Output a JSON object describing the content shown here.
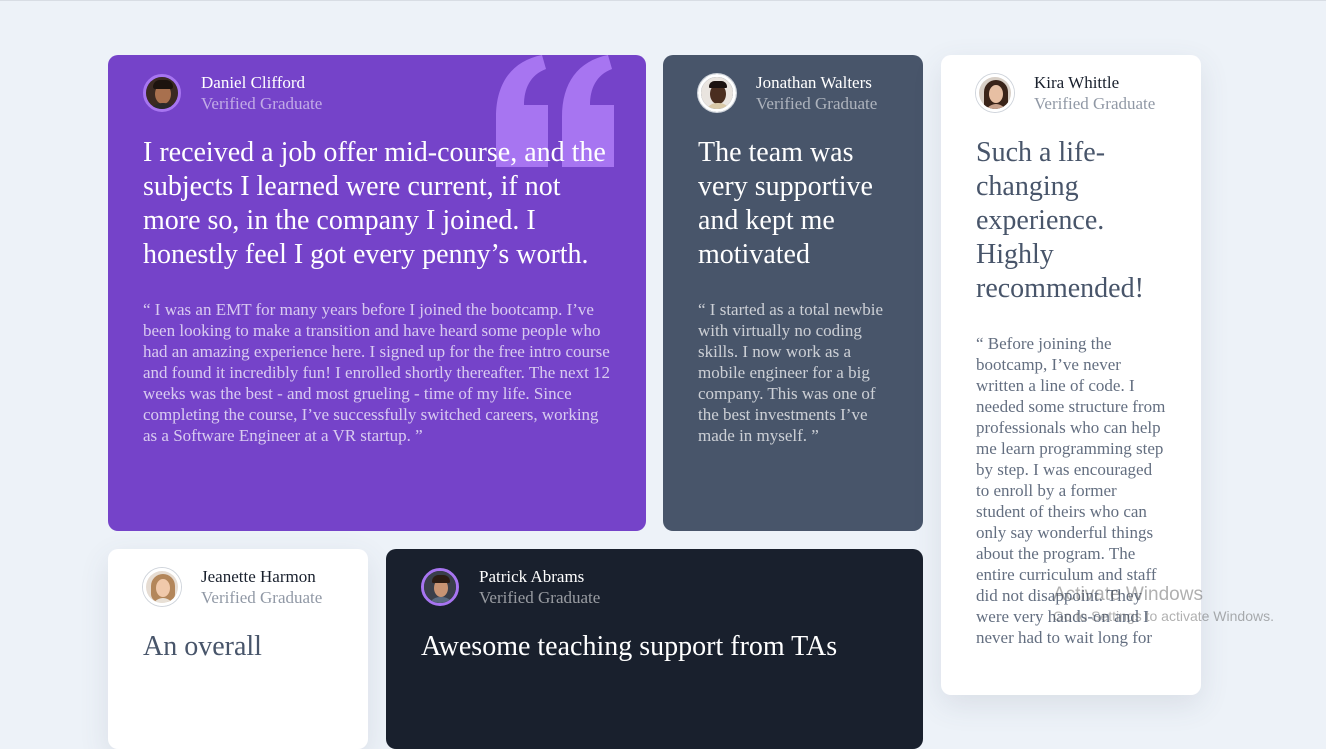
{
  "testimonials": [
    {
      "name": "Daniel Clifford",
      "role": "Verified Graduate",
      "title": "I received a job offer mid-course, and the subjects I learned were current, if not more so, in the company I joined. I honestly feel I got every penny’s worth.",
      "body": "“ I was an EMT for many years before I joined the bootcamp. I’ve been looking to make a transition and have heard some people who had an amazing experience here. I signed up for the free intro course and found it incredibly fun! I enrolled shortly thereafter. The next 12 weeks was the best - and most grueling - time of my life. Since completing the course, I’ve successfully switched careers, working as a Software Engineer at a VR startup. ”"
    },
    {
      "name": "Jonathan Walters",
      "role": "Verified Graduate",
      "title": "The team was very supportive and kept me motivated",
      "body": "“ I started as a total newbie with virtually no coding skills. I now work as a mobile engineer for a big company. This was one of the best investments I’ve made in myself. ”"
    },
    {
      "name": "Kira Whittle",
      "role": "Verified Graduate",
      "title": "Such a life-changing experience. Highly recommended!",
      "body": "“ Before joining the bootcamp, I’ve never written a line of code. I needed some structure from professionals who can help me learn programming step by step. I was encouraged to enroll by a former student of theirs who can only say wonderful things about the program. The entire curriculum and staff did not disappoint. They were very hands-on and I never had to wait long for"
    },
    {
      "name": "Jeanette Harmon",
      "role": "Verified Graduate",
      "title": "An overall"
    },
    {
      "name": "Patrick Abrams",
      "role": "Verified Graduate",
      "title": "Awesome teaching support from TAs"
    }
  ],
  "watermark": {
    "title": "Activate Windows",
    "subtitle": "Go to Settings to activate Windows."
  },
  "colors": {
    "background": "#edf2f8",
    "purple": "#7543c9",
    "slate": "#48556a",
    "dark": "#19202d",
    "white": "#ffffff",
    "quote": "#a775f1"
  }
}
